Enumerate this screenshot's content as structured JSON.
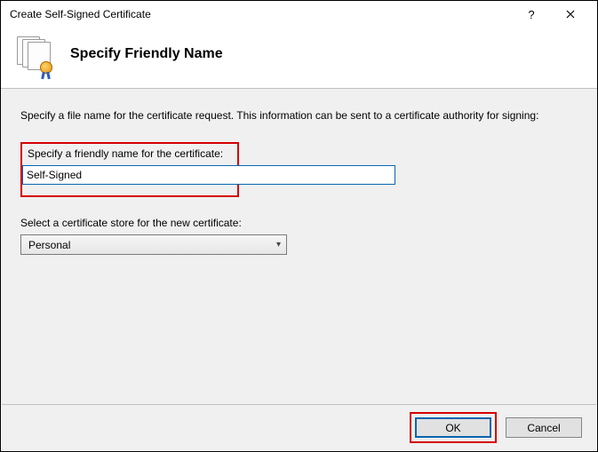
{
  "window": {
    "title": "Create Self-Signed Certificate"
  },
  "header": {
    "heading": "Specify Friendly Name"
  },
  "body": {
    "instruction": "Specify a file name for the certificate request.  This information can be sent to a certificate authority for signing:",
    "friendly_name_label": "Specify a friendly name for the certificate:",
    "friendly_name_value": "Self-Signed",
    "store_label": "Select a certificate store for the new certificate:",
    "store_selected": "Personal"
  },
  "footer": {
    "ok": "OK",
    "cancel": "Cancel"
  }
}
